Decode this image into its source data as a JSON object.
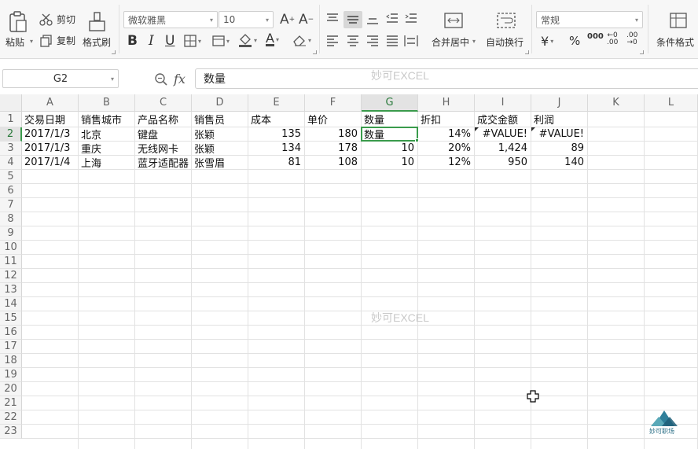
{
  "ribbon": {
    "paste": "粘贴",
    "cut": "剪切",
    "copy": "复制",
    "format_painter": "格式刷",
    "font_name": "微软雅黑",
    "font_size": "10",
    "merge_center": "合并居中",
    "wrap_text": "自动换行",
    "number_format": "常规",
    "conditional_format": "条件格式",
    "bold": "B",
    "italic": "I",
    "underline": "U",
    "percent": "%",
    "thousands": "000"
  },
  "formula_bar": {
    "name_box": "G2",
    "fx": "fx",
    "content": "数量"
  },
  "watermark": "妙可EXCEL",
  "logo_text": "妙可职场",
  "columns": [
    "A",
    "B",
    "C",
    "D",
    "E",
    "F",
    "G",
    "H",
    "I",
    "J",
    "K",
    "L"
  ],
  "rows": [
    "1",
    "2",
    "3",
    "4",
    "5",
    "6",
    "7",
    "8",
    "9",
    "10",
    "11",
    "12",
    "13",
    "14",
    "15",
    "16",
    "17",
    "18",
    "19",
    "20",
    "21",
    "22",
    "23"
  ],
  "active_cell": {
    "column": "G",
    "row": "2"
  },
  "sheet": {
    "header": [
      "交易日期",
      "销售城市",
      "产品名称",
      "销售员",
      "成本",
      "单价",
      "数量",
      "折扣",
      "成交金额",
      "利润"
    ],
    "rows": [
      [
        "2017/1/3",
        "北京",
        "键盘",
        "张颖",
        "135",
        "180",
        "数量",
        "14%",
        "#VALUE!",
        "#VALUE!"
      ],
      [
        "2017/1/3",
        "重庆",
        "无线网卡",
        "张颖",
        "134",
        "178",
        "10",
        "20%",
        "1,424",
        "89"
      ],
      [
        "2017/1/4",
        "上海",
        "蓝牙适配器",
        "张雪眉",
        "81",
        "108",
        "10",
        "12%",
        "950",
        "140"
      ]
    ]
  }
}
